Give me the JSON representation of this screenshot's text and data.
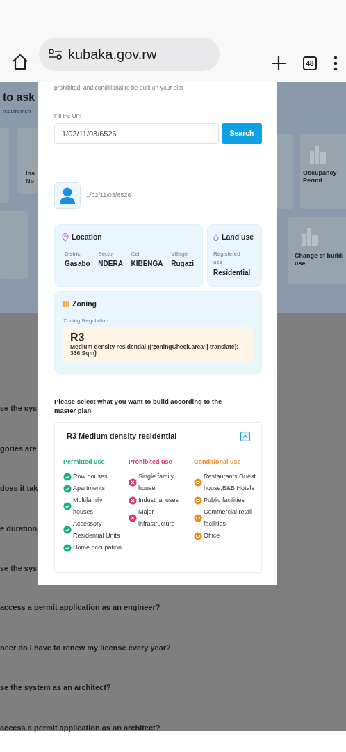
{
  "browser": {
    "url": "kubaka.gov.rw",
    "tab_count": "48"
  },
  "background": {
    "heading": "to ask",
    "subheading": "requiremen",
    "left_card": {
      "lines": [
        "Ins",
        "No"
      ]
    },
    "right_cards": [
      {
        "lines": [
          "Occupancy",
          "Permit"
        ]
      },
      {
        "lines": [
          "Change of buildi",
          "use"
        ]
      }
    ],
    "left_questions": [
      "se the sys",
      "gories are",
      "does it tak",
      "e duration",
      "se the sys"
    ],
    "questions": [
      "access a permit application as an engineer?",
      "neer do I have to renew my license every year?",
      "se the system as an architect?",
      "access a permit application as an architect?"
    ]
  },
  "modal": {
    "intro": "prohibited, and conditional to be built on your plot",
    "upi_label": "Fill the UPI",
    "upi_value": "1/02/11/03/6526",
    "search_button": "Search",
    "plot_upi": "1/02/11/03/6526",
    "location": {
      "title": "Location",
      "fields": [
        {
          "label": "District",
          "value": "Gasabo"
        },
        {
          "label": "Sector",
          "value": "NDERA"
        },
        {
          "label": "Cell",
          "value": "KIBENGA"
        },
        {
          "label": "Village",
          "value": "Rugazi"
        }
      ]
    },
    "land_use": {
      "title": "Land use",
      "label": "Registered use",
      "value": "Residential"
    },
    "zoning": {
      "title": "Zoning",
      "label": "Zoning Regulation",
      "code": "R3",
      "description": "Medium density residential (('zoningCheck.area' | translate): 336 Sqm)"
    },
    "prompt": "Please select what you want to build according to the master plan",
    "plan": {
      "title": "R3 Medium density residential",
      "expanded": true,
      "columns": [
        {
          "kind": "permitted",
          "title": "Permitted use",
          "items": [
            "Row houses",
            "Apartments",
            "Multifamily houses",
            "Accessory Residential Units",
            "Home occupation"
          ]
        },
        {
          "kind": "prohibited",
          "title": "Prohibited use",
          "items": [
            "Single family house",
            "Industrial uses",
            "Major infrastructure"
          ]
        },
        {
          "kind": "conditional",
          "title": "Conditional use",
          "items": [
            "Restaurants,Guest house,B&B,Hotels",
            "Public facilities",
            "Commercial retail facilities",
            "Office"
          ]
        }
      ]
    }
  }
}
